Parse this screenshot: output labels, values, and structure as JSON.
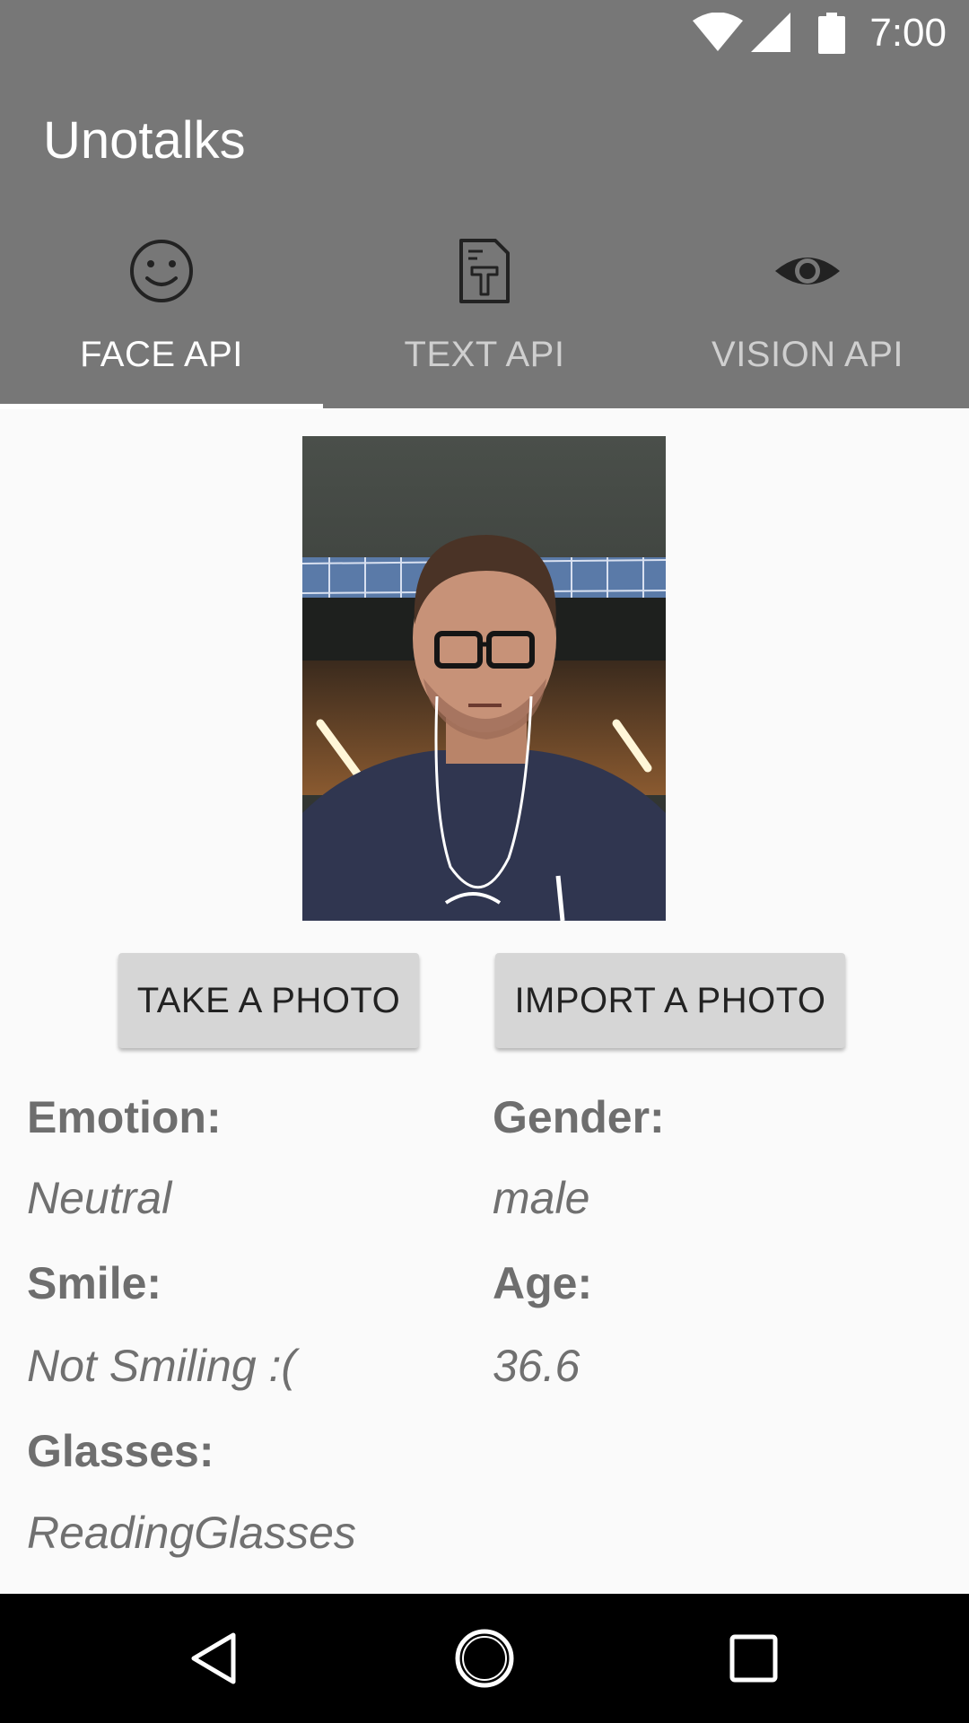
{
  "status_bar": {
    "time": "7:00",
    "icons": [
      "wifi-icon",
      "cell-signal-icon",
      "battery-icon"
    ]
  },
  "app": {
    "title": "Unotalks"
  },
  "tabs": [
    {
      "label": "FACE API",
      "icon": "smiley-face-icon",
      "active": true
    },
    {
      "label": "TEXT API",
      "icon": "text-document-icon",
      "active": false
    },
    {
      "label": "VISION API",
      "icon": "eye-icon",
      "active": false
    }
  ],
  "photo": {
    "description_icon": "selfie-photo"
  },
  "actions": {
    "take_photo": "TAKE A PHOTO",
    "import_photo": "IMPORT A PHOTO"
  },
  "results": {
    "emotion_label": "Emotion:",
    "emotion_value": "Neutral",
    "gender_label": "Gender:",
    "gender_value": "male",
    "smile_label": "Smile:",
    "smile_value": "Not Smiling :(",
    "age_label": "Age:",
    "age_value": "36.6",
    "glasses_label": "Glasses:",
    "glasses_value": "ReadingGlasses"
  },
  "nav_bar": {
    "buttons": [
      "back-icon",
      "home-icon",
      "recents-icon"
    ]
  },
  "colors": {
    "app_bar": "#777777",
    "background": "#fafafa",
    "button": "#d6d6d6",
    "nav_bar": "#000000"
  }
}
